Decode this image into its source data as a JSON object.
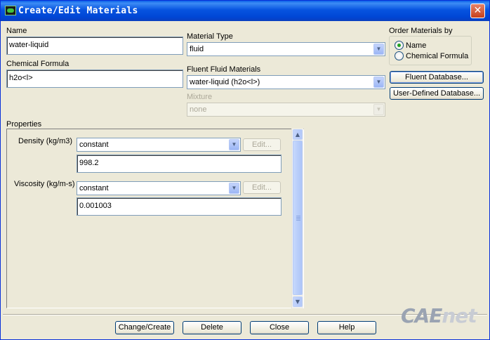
{
  "window": {
    "title": "Create/Edit Materials"
  },
  "name": {
    "label": "Name",
    "value": "water-liquid"
  },
  "chemical_formula": {
    "label": "Chemical Formula",
    "value": "h2o<l>"
  },
  "material_type": {
    "label": "Material Type",
    "value": "fluid"
  },
  "fluent_fluid_materials": {
    "label": "Fluent Fluid Materials",
    "value": "water-liquid (h2o<l>)"
  },
  "mixture": {
    "label": "Mixture",
    "value": "none"
  },
  "order_by": {
    "label": "Order Materials by",
    "options": [
      {
        "label": "Name",
        "selected": true
      },
      {
        "label": "Chemical Formula",
        "selected": false
      }
    ]
  },
  "db_buttons": {
    "fluent_database": "Fluent Database...",
    "user_defined_database": "User-Defined Database..."
  },
  "properties": {
    "label": "Properties",
    "items": [
      {
        "label": "Density (kg/m3)",
        "method": "constant",
        "edit": "Edit...",
        "value": "998.2"
      },
      {
        "label": "Viscosity (kg/m-s)",
        "method": "constant",
        "edit": "Edit...",
        "value": "0.001003"
      }
    ]
  },
  "actions": {
    "change_create": "Change/Create",
    "delete": "Delete",
    "close": "Close",
    "help": "Help"
  },
  "watermark": {
    "part1": "CAE",
    "part2": "net"
  },
  "colors": {
    "titlebar": "#0054e3",
    "face": "#ece9d8",
    "border": "#7f9db9",
    "radio_dot": "#21a121"
  }
}
